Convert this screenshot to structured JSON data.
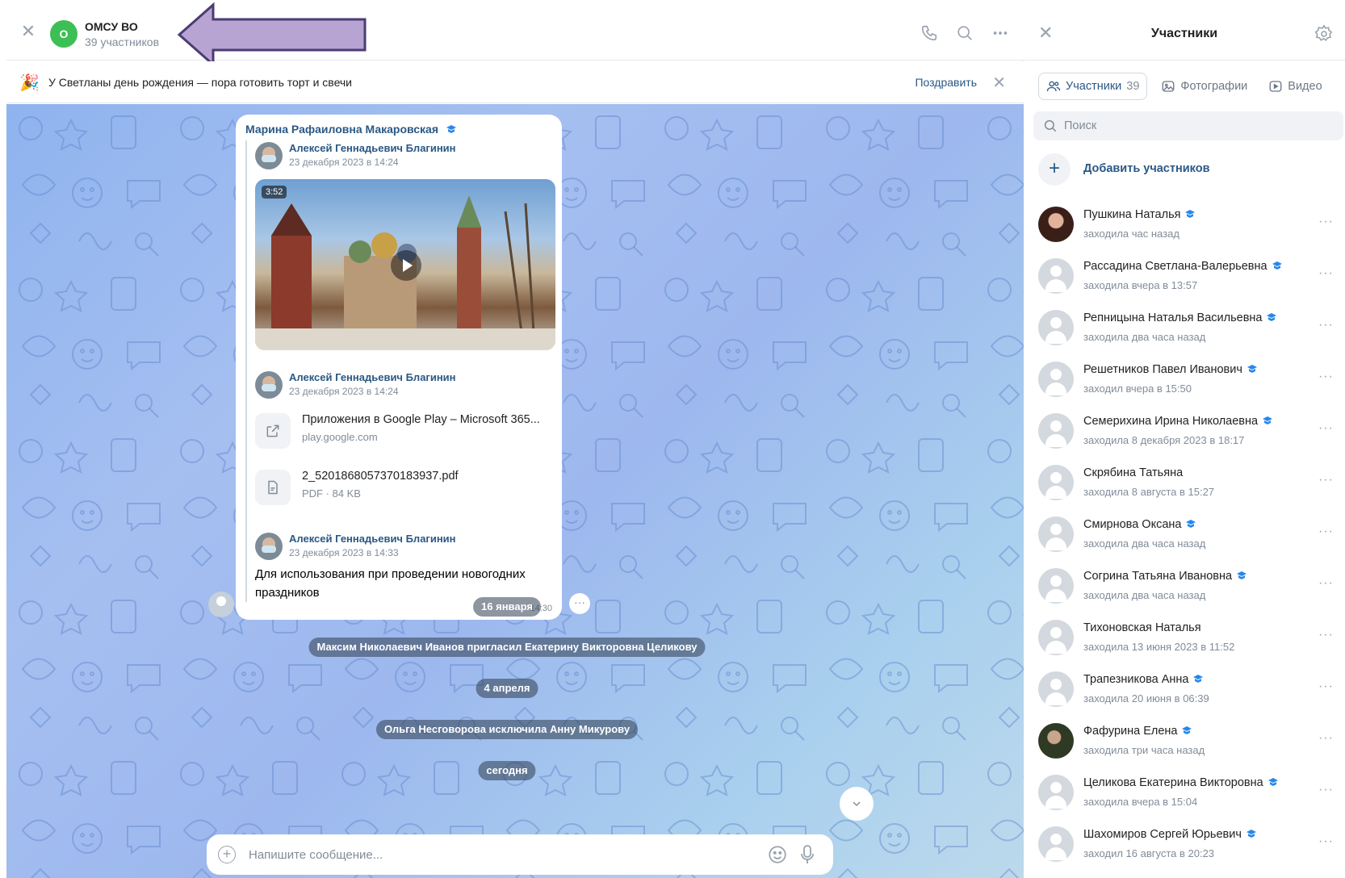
{
  "colors": {
    "accent": "#2a5885",
    "online_green": "#3cbf54",
    "arrow_fill": "#b8a4d2",
    "arrow_stroke": "#4a3c74"
  },
  "header": {
    "avatar_letter": "О",
    "title": "ОМСУ ВО",
    "subtitle": "39 участников",
    "icons": [
      "close-icon",
      "phone-icon",
      "search-icon",
      "more-icon"
    ]
  },
  "banner": {
    "text": "У Светланы день рождения — пора готовить торт и свечи",
    "action": "Поздравить",
    "icon": "party-popper-icon"
  },
  "message": {
    "author": "Марина Рафаиловна Макаровская",
    "forwards": [
      {
        "name": "Алексей Геннадьевич Благинин",
        "date": "23 декабря 2023 в 14:24",
        "video_duration": "3:52"
      },
      {
        "name": "Алексей Геннадьевич Благинин",
        "date": "23 декабря 2023 в 14:24",
        "link_title": "Приложения в Google Play – Microsoft 365...",
        "link_domain": "play.google.com",
        "file_name": "2_5201868057370183937.pdf",
        "file_meta": "PDF · 84 KB"
      },
      {
        "name": "Алексей Геннадьевич Благинин",
        "date": "23 декабря 2023 в 14:33",
        "text": "Для использования при проведении новогодних праздников"
      }
    ],
    "time": "14:30"
  },
  "system_messages": [
    "16 января",
    "Максим Николаевич Иванов пригласил Екатерину Викторовна Целикову",
    "4 апреля",
    "Ольга Несговорова исключила Анну Микурову",
    "сегодня"
  ],
  "composer": {
    "placeholder": "Напишите сообщение..."
  },
  "panel": {
    "title": "Участники",
    "tabs": [
      {
        "label": "Участники",
        "count": "39",
        "icon": "users-icon"
      },
      {
        "label": "Фотографии",
        "icon": "photo-icon"
      },
      {
        "label": "Видео",
        "icon": "video-icon"
      }
    ],
    "search_placeholder": "Поиск",
    "add_label": "Добавить участников",
    "members": [
      {
        "name": "Пушкина Наталья",
        "status": "заходила час назад"
      },
      {
        "name": "Рассадина Светлана-Валерьевна",
        "status": "заходила вчера в 13:57"
      },
      {
        "name": "Репницына Наталья Васильевна",
        "status": "заходила два часа назад"
      },
      {
        "name": "Решетников Павел Иванович",
        "status": "заходил вчера в 15:50"
      },
      {
        "name": "Семерихина Ирина Николаевна",
        "status": "заходила 8 декабря 2023 в 18:17"
      },
      {
        "name": "Скрябина Татьяна",
        "status": "заходила 8 августа в 15:27"
      },
      {
        "name": "Смирнова Оксана",
        "status": "заходила два часа назад"
      },
      {
        "name": "Согрина Татьяна Ивановна",
        "status": "заходила два часа назад"
      },
      {
        "name": "Тихоновская Наталья",
        "status": "заходила 13 июня 2023 в 11:52"
      },
      {
        "name": "Трапезникова Анна",
        "status": "заходила 20 июня в 06:39"
      },
      {
        "name": "Фафурина Елена",
        "status": "заходила три часа назад"
      },
      {
        "name": "Целикова Екатерина Викторовна",
        "status": "заходила вчера в 15:04"
      },
      {
        "name": "Шахомиров Сергей Юрьевич",
        "status": "заходил 16 августа в 20:23"
      }
    ]
  }
}
